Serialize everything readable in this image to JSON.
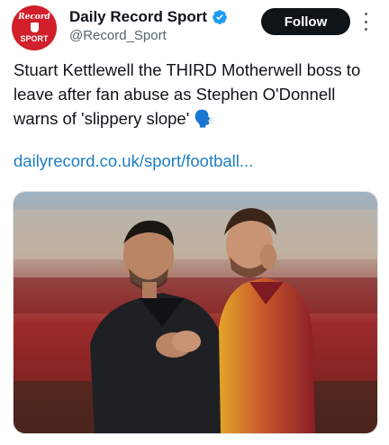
{
  "author": {
    "display_name": "Daily Record Sport",
    "handle": "@Record_Sport",
    "avatar_text_top": "Record",
    "avatar_text_bottom": "SPORT"
  },
  "follow_label": "Follow",
  "tweet": {
    "text": "Stuart Kettlewell the THIRD Motherwell boss to leave after fan abuse as Stephen O'Donnell warns of 'slippery slope' 🗣️",
    "link": "dailyrecord.co.uk/sport/football..."
  },
  "colors": {
    "accent_link": "#1d7ec2",
    "verified": "#1d9bf0",
    "brand_red": "#d11f2b",
    "follow_bg": "#0f1419"
  },
  "icons": [
    "verified-badge-icon",
    "more-options-icon"
  ]
}
